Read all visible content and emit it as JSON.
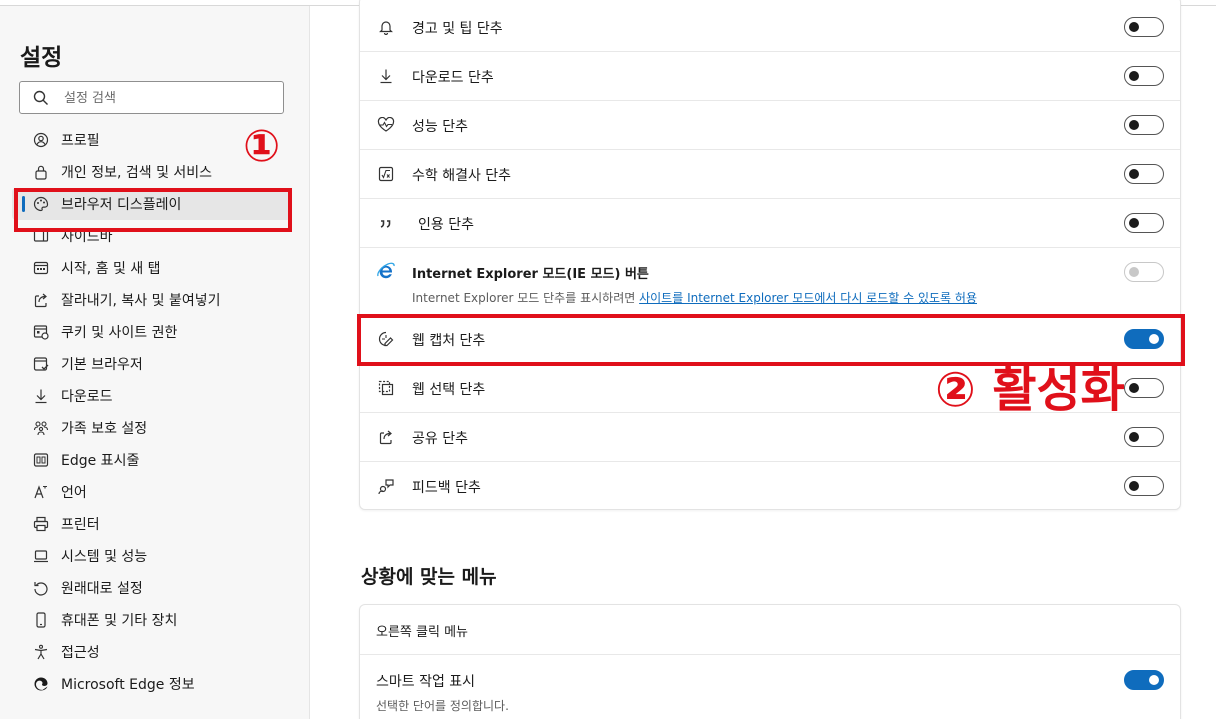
{
  "sidebar": {
    "title": "설정",
    "search_placeholder": "설정 검색",
    "items": [
      {
        "label": "프로필",
        "icon": "profile-icon"
      },
      {
        "label": "개인 정보, 검색 및 서비스",
        "icon": "lock-icon"
      },
      {
        "label": "브라우저 디스플레이",
        "icon": "palette-icon"
      },
      {
        "label": "사이드바",
        "icon": "sidebar-icon"
      },
      {
        "label": "시작, 홈 및 새 탭",
        "icon": "home-tab-icon"
      },
      {
        "label": "잘라내기, 복사 및 붙여넣기",
        "icon": "share-icon"
      },
      {
        "label": "쿠키 및 사이트 권한",
        "icon": "cookie-icon"
      },
      {
        "label": "기본 브라우저",
        "icon": "browser-icon"
      },
      {
        "label": "다운로드",
        "icon": "download-icon"
      },
      {
        "label": "가족 보호 설정",
        "icon": "family-icon"
      },
      {
        "label": "Edge 표시줄",
        "icon": "edge-bar-icon"
      },
      {
        "label": "언어",
        "icon": "language-icon"
      },
      {
        "label": "프린터",
        "icon": "printer-icon"
      },
      {
        "label": "시스템 및 성능",
        "icon": "laptop-icon"
      },
      {
        "label": "원래대로 설정",
        "icon": "reset-icon"
      },
      {
        "label": "휴대폰 및 기타 장치",
        "icon": "phone-icon"
      },
      {
        "label": "접근성",
        "icon": "accessibility-icon"
      },
      {
        "label": "Microsoft Edge 정보",
        "icon": "edge-logo-icon"
      }
    ]
  },
  "main": {
    "rows": [
      {
        "label": "경고 및 팁 단추",
        "icon": "bell-icon",
        "toggle": "off"
      },
      {
        "label": "다운로드 단추",
        "icon": "download-icon",
        "toggle": "off"
      },
      {
        "label": "성능 단추",
        "icon": "heartbeat-icon",
        "toggle": "off"
      },
      {
        "label": "수학 해결사 단추",
        "icon": "math-icon",
        "toggle": "off"
      },
      {
        "label": "인용 단추",
        "icon": "quote-icon",
        "toggle": "off"
      },
      {
        "label": "Internet Explorer 모드(IE 모드) 버튼",
        "icon": "ie-logo-icon",
        "toggle": "disabled",
        "subtitle_prefix": "Internet Explorer 모드 단추를 표시하려면 ",
        "subtitle_link": "사이트를 Internet Explorer 모드에서 다시 로드할 수 있도록 허용"
      },
      {
        "label": "웹 캡처 단추",
        "icon": "web-capture-icon",
        "toggle": "on"
      },
      {
        "label": "웹 선택 단추",
        "icon": "web-select-icon",
        "toggle": "off"
      },
      {
        "label": "공유 단추",
        "icon": "share-icon",
        "toggle": "off"
      },
      {
        "label": "피드백 단추",
        "icon": "feedback-icon",
        "toggle": "off"
      }
    ],
    "section_title": "상황에 맞는 메뉴",
    "context_menu": {
      "header": "오른쪽 클릭 메뉴",
      "smart_actions_label": "스마트 작업 표시",
      "smart_actions_subtitle": "선택한 단어를 정의합니다.",
      "smart_actions_toggle": "on"
    }
  },
  "annotations": {
    "step1": "①",
    "step2": "② 활성화"
  },
  "colors": {
    "accent": "#0f6cbd",
    "annotation": "#e0101a"
  }
}
